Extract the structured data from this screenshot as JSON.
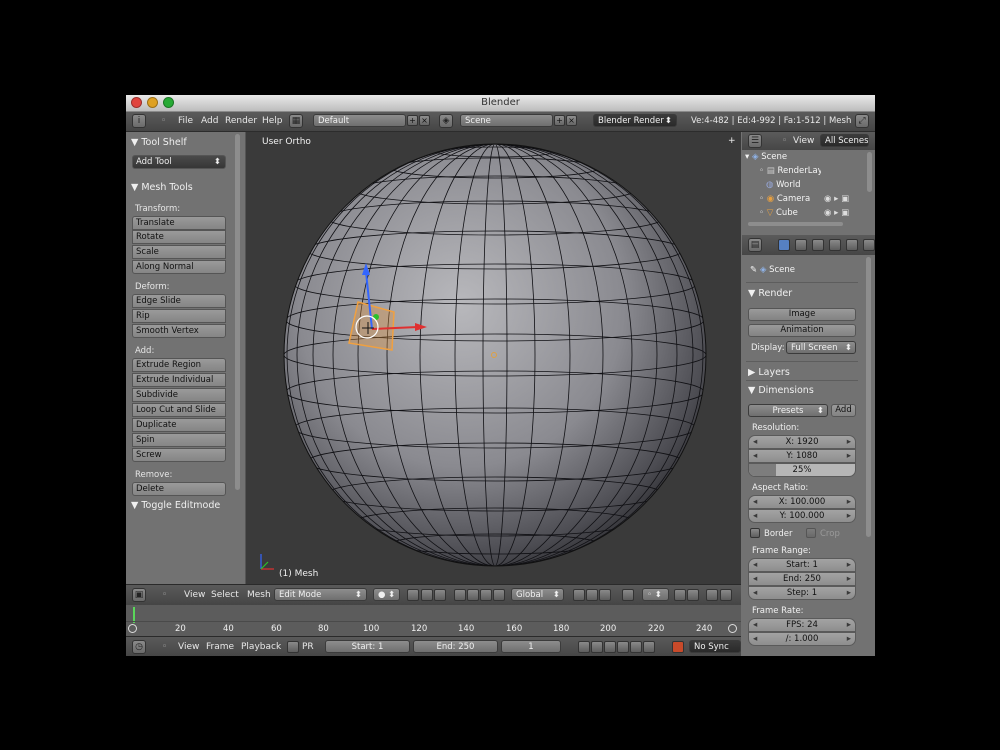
{
  "window": {
    "title": "Blender"
  },
  "topbar": {
    "menus": [
      "File",
      "Add",
      "Render",
      "Help"
    ],
    "screen_layout": "Default",
    "scene": "Scene",
    "engine": "Blender Render",
    "stats": "Ve:4-482 | Ed:4-992 | Fa:1-512 | Mesh"
  },
  "toolshelf": {
    "title": "Tool Shelf",
    "add_tool": "Add Tool",
    "mesh_tools": "Mesh Tools",
    "transform_label": "Transform:",
    "transform": [
      "Translate",
      "Rotate",
      "Scale",
      "Along Normal"
    ],
    "deform_label": "Deform:",
    "deform": [
      "Edge Slide",
      "Rip",
      "Smooth Vertex"
    ],
    "add_label": "Add:",
    "add": [
      "Extrude Region",
      "Extrude Individual",
      "Subdivide",
      "Loop Cut and Slide",
      "Duplicate",
      "Spin",
      "Screw"
    ],
    "remove_label": "Remove:",
    "remove": [
      "Delete"
    ],
    "toggle_editmode": "Toggle Editmode"
  },
  "viewport": {
    "view_label": "User Ortho",
    "object_label": "(1) Mesh"
  },
  "view3d_header": {
    "menus": [
      "View",
      "Select",
      "Mesh"
    ],
    "mode": "Edit Mode",
    "orientation": "Global"
  },
  "timeline": {
    "ticks": [
      "0",
      "20",
      "40",
      "60",
      "80",
      "100",
      "120",
      "140",
      "160",
      "180",
      "200",
      "220",
      "240"
    ]
  },
  "timeline_header": {
    "menus": [
      "View",
      "Frame",
      "Playback"
    ],
    "pr": "PR",
    "start": "Start: 1",
    "end": "End: 250",
    "current": "1",
    "sync": "No Sync"
  },
  "outliner": {
    "view_menu": "View",
    "filter": "All Scenes",
    "items": [
      "Scene",
      "RenderLayers",
      "World",
      "Camera",
      "Cube"
    ]
  },
  "properties": {
    "context": "Scene",
    "render_section": "Render",
    "image_button": "Image",
    "animation_button": "Animation",
    "display_label": "Display:",
    "display_value": "Full Screen",
    "layers_section": "Layers",
    "dimensions_section": "Dimensions",
    "presets": "Presets",
    "add": "Add",
    "resolution_label": "Resolution:",
    "res_x": "X: 1920",
    "res_y": "Y: 1080",
    "res_pct": "25%",
    "res_pct_value": 0.25,
    "aspect_label": "Aspect Ratio:",
    "aspect_x": "X: 100.000",
    "aspect_y": "Y: 100.000",
    "border": "Border",
    "crop": "Crop",
    "frame_range_label": "Frame Range:",
    "fr_start": "Start: 1",
    "fr_end": "End: 250",
    "fr_step": "Step: 1",
    "frame_rate_label": "Frame Rate:",
    "fps": "FPS: 24",
    "fps_base": "/: 1.000"
  }
}
